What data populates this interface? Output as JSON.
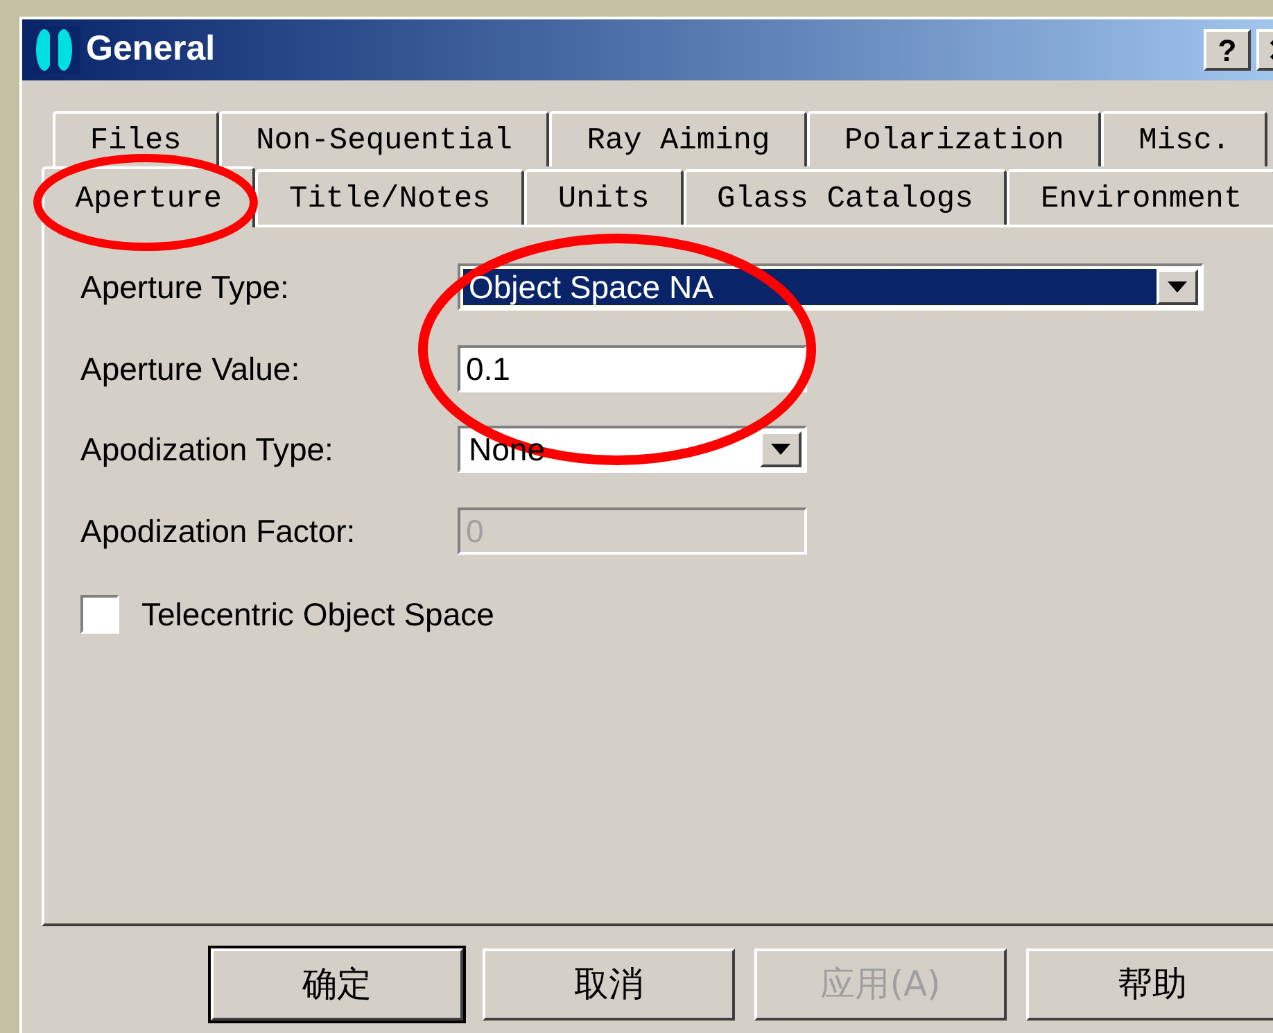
{
  "window": {
    "title": "General",
    "help_button": "?"
  },
  "tab_rows": [
    [
      {
        "label": "Files",
        "selected": false
      },
      {
        "label": "Non-Sequential",
        "selected": false
      },
      {
        "label": "Ray Aiming",
        "selected": false
      },
      {
        "label": "Polarization",
        "selected": false
      },
      {
        "label": "Misc.",
        "selected": false
      }
    ],
    [
      {
        "label": "Aperture",
        "selected": true
      },
      {
        "label": "Title/Notes",
        "selected": false
      },
      {
        "label": "Units",
        "selected": false
      },
      {
        "label": "Glass Catalogs",
        "selected": false
      },
      {
        "label": "Environment",
        "selected": false
      }
    ]
  ],
  "fields": [
    {
      "kind": "combo",
      "label": "Aperture Type:",
      "value": "Object Space NA",
      "focused": true,
      "disabled": false
    },
    {
      "kind": "text",
      "label": "Aperture Value:",
      "value": "0.1",
      "disabled": false
    },
    {
      "kind": "combo",
      "label": "Apodization Type:",
      "value": "None",
      "focused": false,
      "disabled": false
    },
    {
      "kind": "text",
      "label": "Apodization Factor:",
      "value": "0",
      "disabled": true
    }
  ],
  "checkbox": {
    "label": "Telecentric Object Space",
    "checked": false
  },
  "buttons": [
    {
      "label": "确定",
      "default": true,
      "disabled": false
    },
    {
      "label": "取消",
      "default": false,
      "disabled": false
    },
    {
      "label": "应用(A)",
      "default": false,
      "disabled": true
    },
    {
      "label": "帮助",
      "default": false,
      "disabled": false
    }
  ]
}
